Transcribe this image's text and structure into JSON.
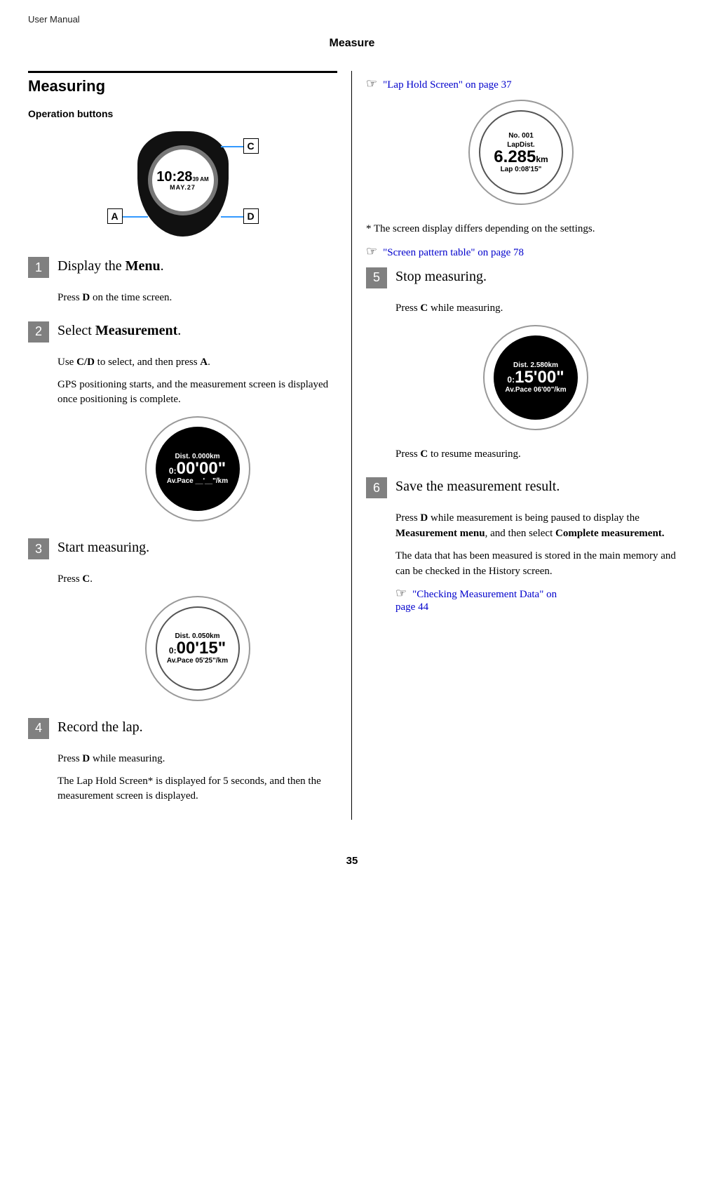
{
  "header": {
    "doc_label": "User Manual",
    "section_title": "Measure"
  },
  "section": {
    "title": "Measuring",
    "subheading": "Operation buttons",
    "buttons_fig": {
      "time": "10:28",
      "time_sub": "39 AM",
      "date": "MAY.27",
      "label_A": "A",
      "label_C": "C",
      "label_D": "D"
    }
  },
  "steps": [
    {
      "num": "1",
      "title_pre": "Display the ",
      "title_bold": "Menu",
      "title_post": ".",
      "body": [
        {
          "pre": "Press ",
          "b1": "D",
          "post": " on the time screen."
        }
      ]
    },
    {
      "num": "2",
      "title_pre": "Select ",
      "title_bold": "Measurement",
      "title_post": ".",
      "body": [
        {
          "pre": "Use ",
          "b1": "C/D",
          "mid": " to select, and then press ",
          "b2": "A",
          "post": "."
        },
        {
          "text": "GPS positioning starts, and the measurement screen is displayed once positioning is complete."
        }
      ],
      "watch": {
        "dark": true,
        "top": "Dist. 0.000km",
        "main_a": "0:",
        "main_b": "00'00\"",
        "bottom": "Av.Pace __'__\"/km"
      }
    },
    {
      "num": "3",
      "title_pre": "Start measuring.",
      "title_bold": "",
      "title_post": "",
      "body": [
        {
          "pre": "Press ",
          "b1": "C",
          "post": "."
        }
      ],
      "watch": {
        "dark": false,
        "top": "Dist. 0.050km",
        "main_a": "0:",
        "main_b": "00'15\"",
        "bottom": "Av.Pace 05'25\"/km"
      }
    },
    {
      "num": "4",
      "title_pre": "Record the lap.",
      "title_bold": "",
      "title_post": "",
      "body": [
        {
          "pre": "Press ",
          "b1": "D",
          "post": " while measuring."
        },
        {
          "text": "The Lap Hold Screen* is displayed for 5 seconds, and then the measurement screen is displayed."
        }
      ]
    }
  ],
  "right": {
    "xref1": "\"Lap Hold Screen\" on page 37",
    "lap_watch": {
      "no": "No. 001",
      "top": "LapDist.",
      "main": "6.285",
      "unit": "km",
      "bottom": "Lap 0:08'15\""
    },
    "footnote": "* The screen display differs depending on the settings.",
    "xref2": "\"Screen pattern table\" on page 78",
    "step5": {
      "num": "5",
      "title": "Stop measuring.",
      "body1_pre": "Press ",
      "body1_b": "C",
      "body1_post": " while measuring.",
      "watch": {
        "dark": true,
        "top": "Dist. 2.580km",
        "main_a": "0:",
        "main_b": "15'00\"",
        "bottom": "Av.Pace 06'00\"/km"
      },
      "body2_pre": "Press ",
      "body2_b": "C",
      "body2_post": " to resume measuring."
    },
    "step6": {
      "num": "6",
      "title": "Save the measurement result.",
      "p1_pre": "Press ",
      "p1_b1": "D",
      "p1_mid": " while measurement is being paused to display the ",
      "p1_b2": "Measurement menu",
      "p1_mid2": ", and then select ",
      "p1_b3": "Complete measurement.",
      "p2": "The data that has been measured is stored in the main memory and can be checked in the History screen.",
      "xref3a": "\"Checking Measurement Data\" on",
      "xref3b": "page 44"
    }
  },
  "hand_glyph": "☞",
  "page_number": "35"
}
